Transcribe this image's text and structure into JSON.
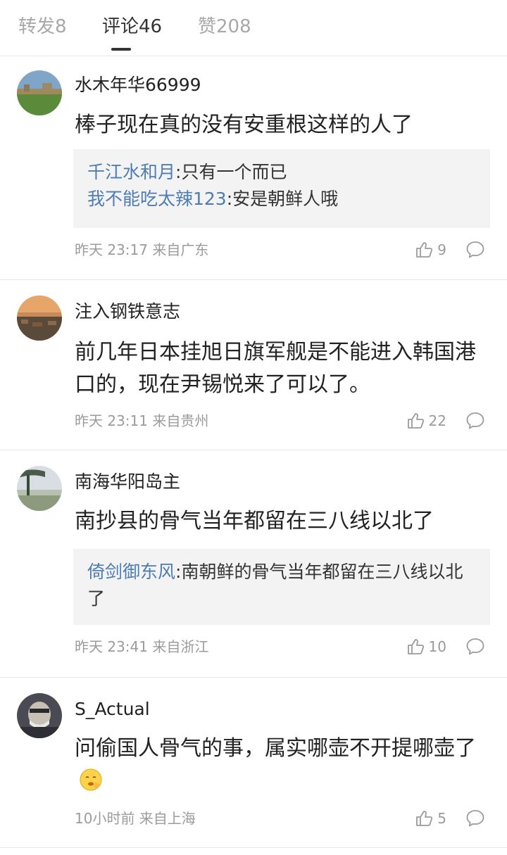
{
  "tabs": [
    {
      "label": "转发8"
    },
    {
      "label": "评论46"
    },
    {
      "label": "赞208"
    }
  ],
  "comments": [
    {
      "username": "水木年华66999",
      "text": "棒子现在真的没有安重根这样的人了",
      "replies": [
        {
          "name": "千江水和月",
          "text": ":只有一个而已"
        },
        {
          "name": "我不能吃太辣123",
          "text": ":安是朝鲜人哦"
        }
      ],
      "time": "昨天 23:17 来自广东",
      "likes": "9"
    },
    {
      "username": "注入钢铁意志",
      "text": "前几年日本挂旭日旗军舰是不能进入韩国港口的，现在尹锡悦来了可以了。",
      "time": "昨天 23:11 来自贵州",
      "likes": "22"
    },
    {
      "username": "南海华阳岛主",
      "text": "南抄县的骨气当年都留在三八线以北了",
      "replies": [
        {
          "name": "倚剑御东风",
          "text": ":南朝鲜的骨气当年都留在三八线以北了"
        }
      ],
      "time": "昨天 23:41 来自浙江",
      "likes": "10"
    },
    {
      "username": "S_Actual",
      "text": "问偷国人骨气的事，属实哪壶不开提哪壶了",
      "time": "10小时前 来自上海",
      "likes": "5"
    }
  ],
  "icons": {
    "like": "thumbs-up-icon",
    "reply": "comment-bubble-icon"
  }
}
